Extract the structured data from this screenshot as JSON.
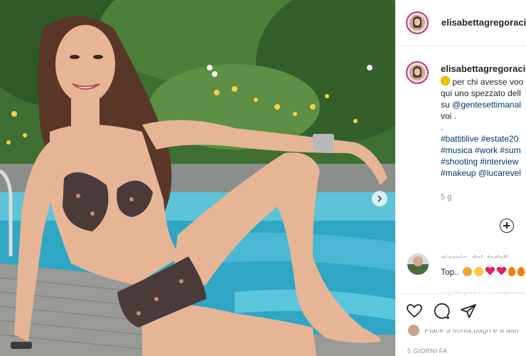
{
  "post": {
    "image_description_icon": "photo",
    "next_icon": "chevron-right-icon"
  },
  "header": {
    "username": "elisabettagregoracire"
  },
  "caption": {
    "username": "elisabettagregoracire",
    "line1": "per chi avesse voo",
    "line2": "qui uno spezzato dell",
    "line3_prefix": "su ",
    "line3_mention": "@gentesettimanal",
    "line4": "voi .",
    "line5": ".",
    "hashtags_line1": "#battitilive #estate20",
    "hashtags_line2": "#musica #work #sum",
    "hashtags_line3": "#shooting #interview",
    "hashtags_line4_tag": "#makeup",
    "hashtags_line4_mention": "@lucarevel",
    "time_ago": "5 g"
  },
  "comment": {
    "username": "giorgio_del_tedell...",
    "text": "Top..",
    "meta": "5 g  Mi piace: 1  Rispondi"
  },
  "actions": {
    "like_icon": "heart-icon",
    "comment_icon": "comment-icon",
    "share_icon": "paper-plane-icon"
  },
  "likes": {
    "text": "Piace a sonia.bagn e a altri"
  },
  "footer": {
    "timestamp": "5 GIORNI FA"
  },
  "colors": {
    "accent_link": "#00376b",
    "text": "#262626",
    "muted": "#8e8e8e",
    "border": "#efefef",
    "avatar_ring": "#c13584"
  }
}
